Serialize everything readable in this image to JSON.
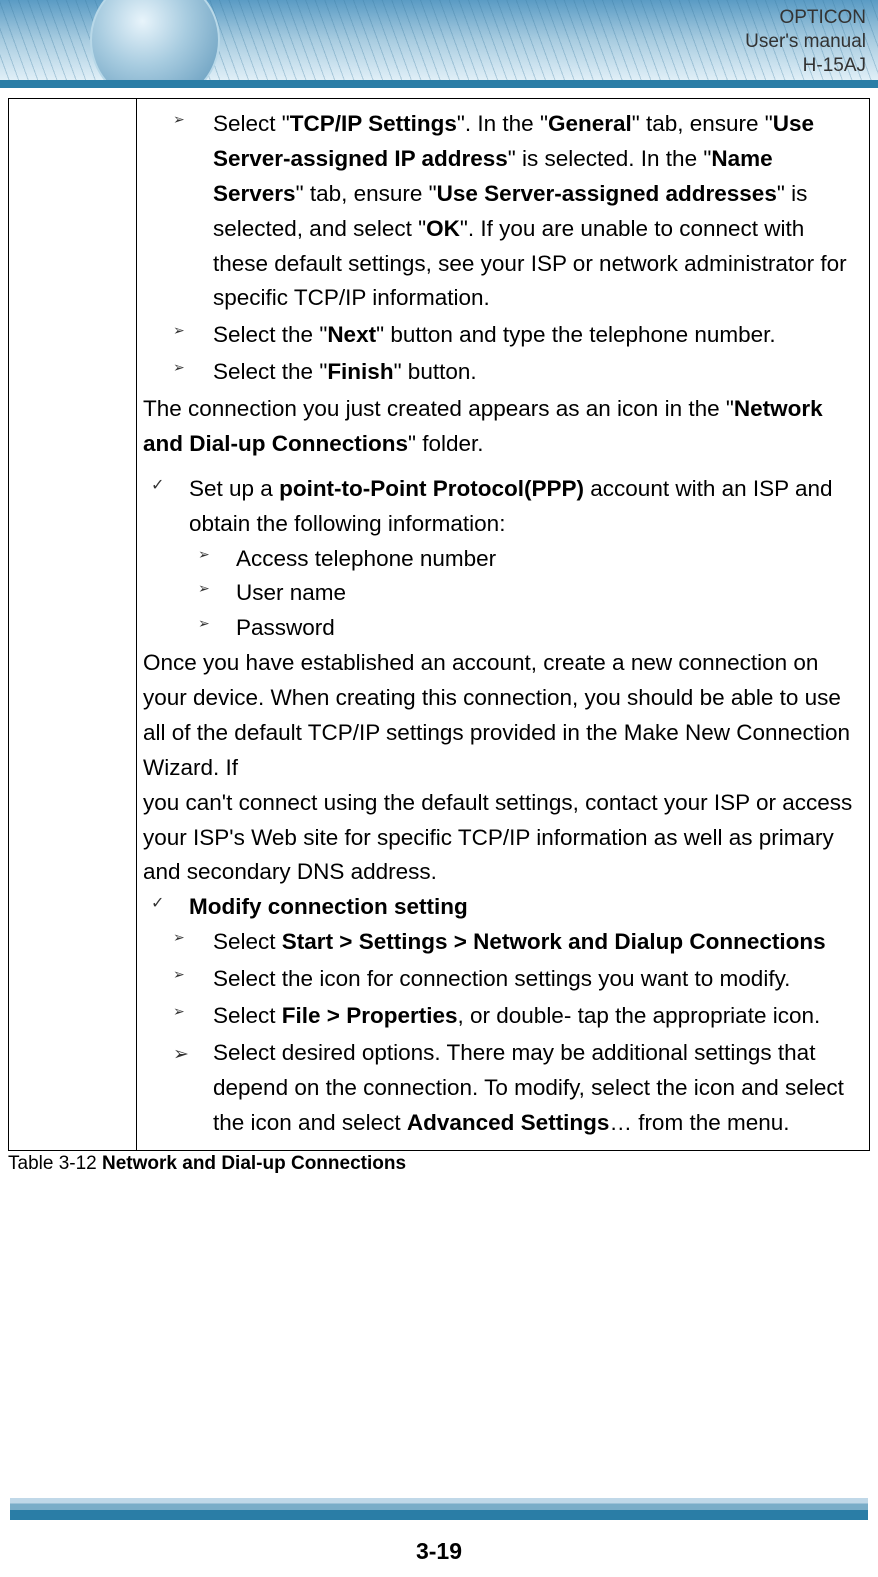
{
  "header": {
    "brand": "OPTICON",
    "subtitle": "User's manual",
    "model": "H-15AJ"
  },
  "content": {
    "item1_parts": {
      "p1": "Select \"",
      "b1": "TCP/IP Settings",
      "p2": "\". In the \"",
      "b2": "General",
      "p3": "\" tab, ensure \"",
      "b3": "Use Server-assigned IP address",
      "p4": "\" is selected. In the \"",
      "b4": "Name Servers",
      "p5": "\" tab, ensure \"",
      "b5": "Use Server-assigned addresses",
      "p6": "\" is selected, and select \"",
      "b6": "OK",
      "p7": "\". If you are unable to connect with these default settings, see your ISP or network administrator for specific TCP/IP information."
    },
    "item2_parts": {
      "p1": "Select the \"",
      "b1": "Next",
      "p2": "\" button and type the telephone number."
    },
    "item3_parts": {
      "p1": "Select the \"",
      "b1": "Finish",
      "p2": "\" button."
    },
    "p_after_parts": {
      "p1": "The connection you just created appears as an icon in the \"",
      "b1": "Network and Dial-up Connections",
      "p2": "\" folder."
    },
    "check1_parts": {
      "p1": "Set up a ",
      "b1": "point-to-Point Protocol(PPP)",
      "p2": " account with an ISP and obtain the following information:"
    },
    "nested": {
      "n1": "Access telephone number",
      "n2": "User name",
      "n3": "Password"
    },
    "para2_l1": "Once you have established an account, create a new connection on your device. When creating this connection, you should be able to use all of the default TCP/IP settings provided in the Make New Connection Wizard. If",
    "para2_l2": "you can't connect using the default settings, contact your ISP or access",
    "para2_l3": "your ISP's Web site for specific TCP/IP information as well as primary and secondary DNS address.",
    "check2": "Modify connection setting",
    "mod1_parts": {
      "p1": "Select ",
      "b1": "Start > Settings > Network and Dialup Connections"
    },
    "mod2": "Select the icon for connection settings you want to modify.",
    "mod3_parts": {
      "p1": "Select ",
      "b1": "File > Properties",
      "p2": ", or double- tap the appropriate icon."
    },
    "mod4_parts": {
      "p1": "Select desired options. There may be additional settings that depend on the connection. To modify, select the icon and select the icon and select ",
      "b1": "Advanced Settings",
      "p2": "… from the menu."
    }
  },
  "caption_parts": {
    "p1": "Table 3-12 ",
    "b1": "Network and Dial-up Connections"
  },
  "pageNumber": "3-19"
}
